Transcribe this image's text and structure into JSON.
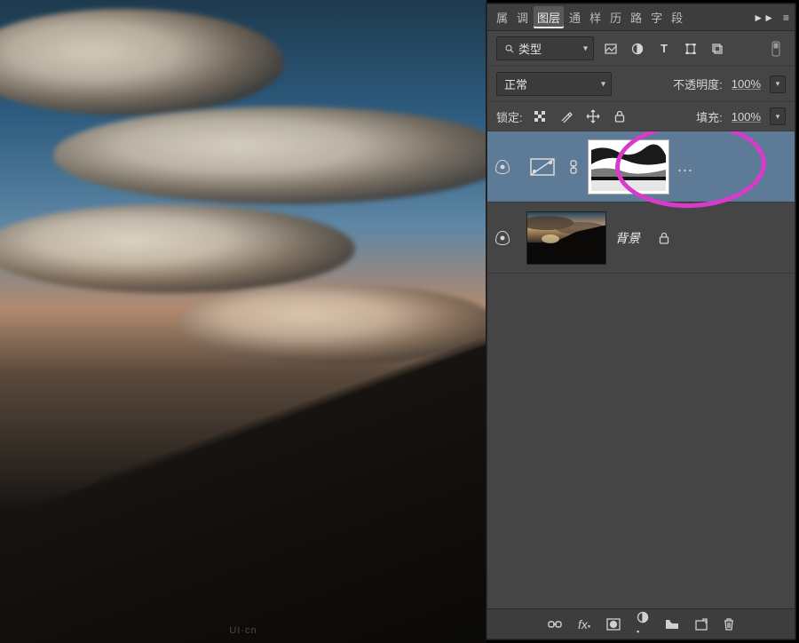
{
  "tabs": {
    "items": [
      "属",
      "调",
      "图层",
      "通",
      "样",
      "历",
      "路",
      "字",
      "段"
    ],
    "active_index": 2
  },
  "filter": {
    "search_icon": "search",
    "type_label": "类型",
    "kind_icons": [
      "image",
      "adjust",
      "type",
      "shape",
      "smart"
    ]
  },
  "blend": {
    "mode_label": "正常",
    "opacity_label": "不透明度:",
    "opacity_value": "100%"
  },
  "lockrow": {
    "lock_label": "锁定:",
    "fill_label": "填充:",
    "fill_value": "100%"
  },
  "layers": [
    {
      "name": "",
      "selected": true,
      "linked": true,
      "is_adjustment": true,
      "has_mask": true,
      "dots": "..."
    },
    {
      "name": "背景",
      "selected": false,
      "locked": true,
      "is_background": true
    }
  ],
  "bottom_icons": [
    "link",
    "fx",
    "mask",
    "adjust",
    "group",
    "new",
    "trash"
  ],
  "watermark": "UI·cn"
}
